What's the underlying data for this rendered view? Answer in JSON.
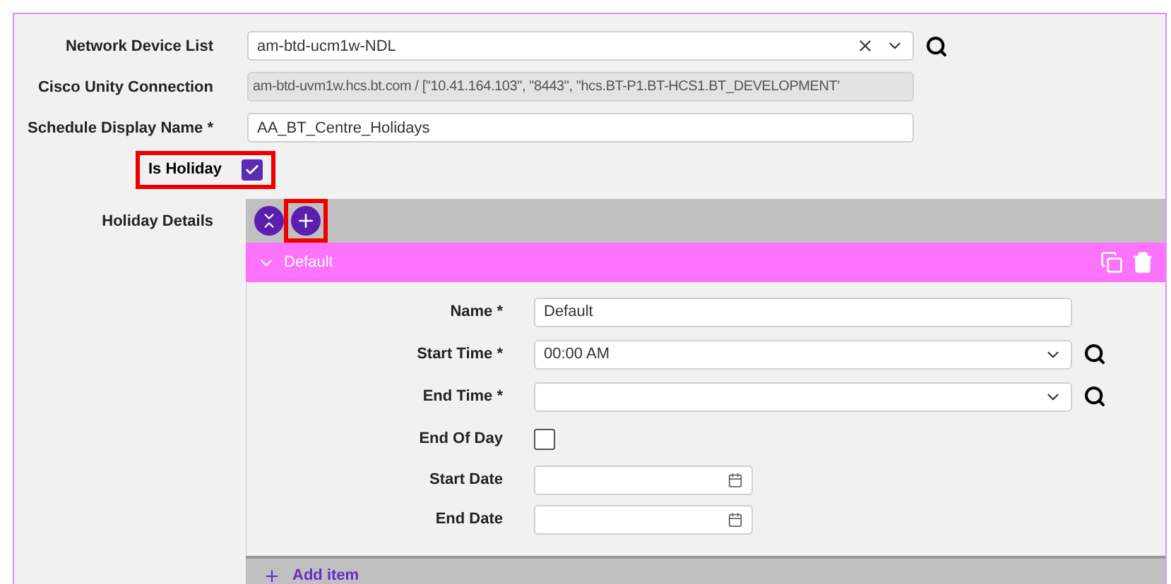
{
  "fields": [
    {
      "kind": "select",
      "label": "Network Device List",
      "value": "am-btd-ucm1w-NDL"
    },
    {
      "kind": "readonly",
      "label": "Cisco Unity Connection",
      "value": "am-btd-uvm1w.hcs.bt.com  /  [\"10.41.164.103\", \"8443\", \"hcs.BT-P1.BT-HCS1.BT_DEVELOPMENT'"
    },
    {
      "kind": "text",
      "label": "Schedule Display Name *",
      "value": "AA_BT_Centre_Holidays"
    },
    {
      "kind": "checkbox",
      "label": "Is Holiday",
      "checked": true,
      "highlighted": true
    }
  ],
  "holiday_details": {
    "label": "Holiday Details",
    "add_highlighted": true,
    "items": [
      {
        "title": "Default",
        "expanded": true,
        "fields": [
          {
            "kind": "text",
            "label": "Name *",
            "value": "Default"
          },
          {
            "kind": "time",
            "label": "Start Time *",
            "value": "00:00 AM"
          },
          {
            "kind": "time",
            "label": "End Time *"
          },
          {
            "kind": "checkbox",
            "label": "End Of Day",
            "checked": false
          },
          {
            "kind": "date",
            "label": "Start Date"
          },
          {
            "kind": "date",
            "label": "End Date"
          }
        ]
      }
    ],
    "add_item": "Add item"
  }
}
